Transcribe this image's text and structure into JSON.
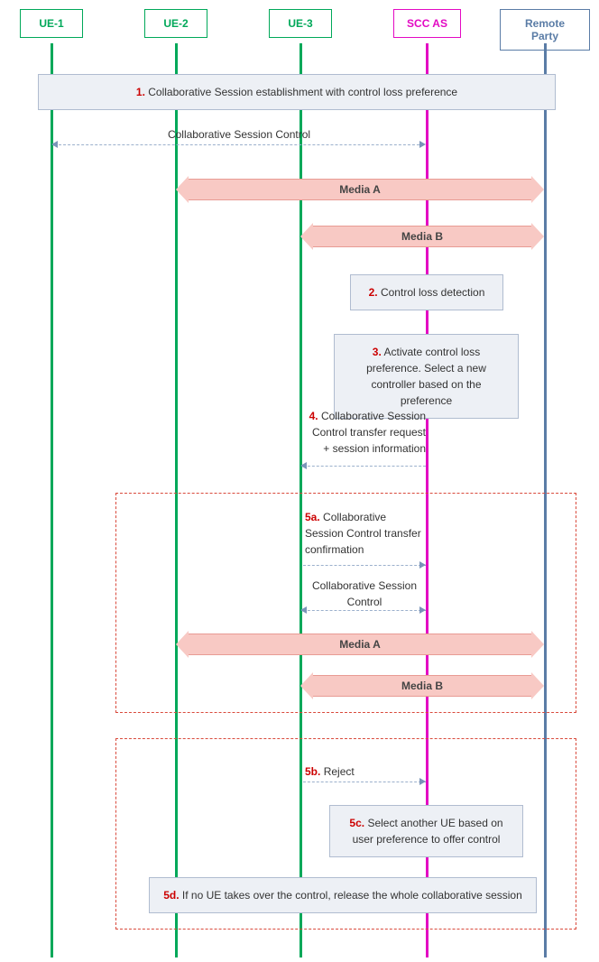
{
  "participants": {
    "ue1": "UE-1",
    "ue2": "UE-2",
    "ue3": "UE-3",
    "scc": "SCC AS",
    "remote": "Remote Party"
  },
  "colors": {
    "ue": "#00a859",
    "scc": "#e30ac3",
    "remote": "#5a7ca6"
  },
  "steps": {
    "s1": {
      "num": "1.",
      "text": "Collaborative Session establishment with control loss preference"
    },
    "s2": {
      "num": "2.",
      "text": "Control loss detection"
    },
    "s3": {
      "num": "3.",
      "text": "Activate control loss preference. Select a new controller based on the preference"
    },
    "s4": {
      "num": "4.",
      "text": "Collaborative Session Control transfer request + session information"
    },
    "s5a": {
      "num": "5a.",
      "text": "Collaborative Session Control transfer confirmation"
    },
    "s5b": {
      "num": "5b.",
      "text": "Reject"
    },
    "s5c": {
      "num": "5c.",
      "text": "Select another UE based on user preference to offer control"
    },
    "s5d": {
      "num": "5d.",
      "text": "If no UE takes over the control, release the whole collaborative session"
    }
  },
  "labels": {
    "csc": "Collaborative Session Control",
    "mediaA": "Media A",
    "mediaB": "Media B"
  }
}
